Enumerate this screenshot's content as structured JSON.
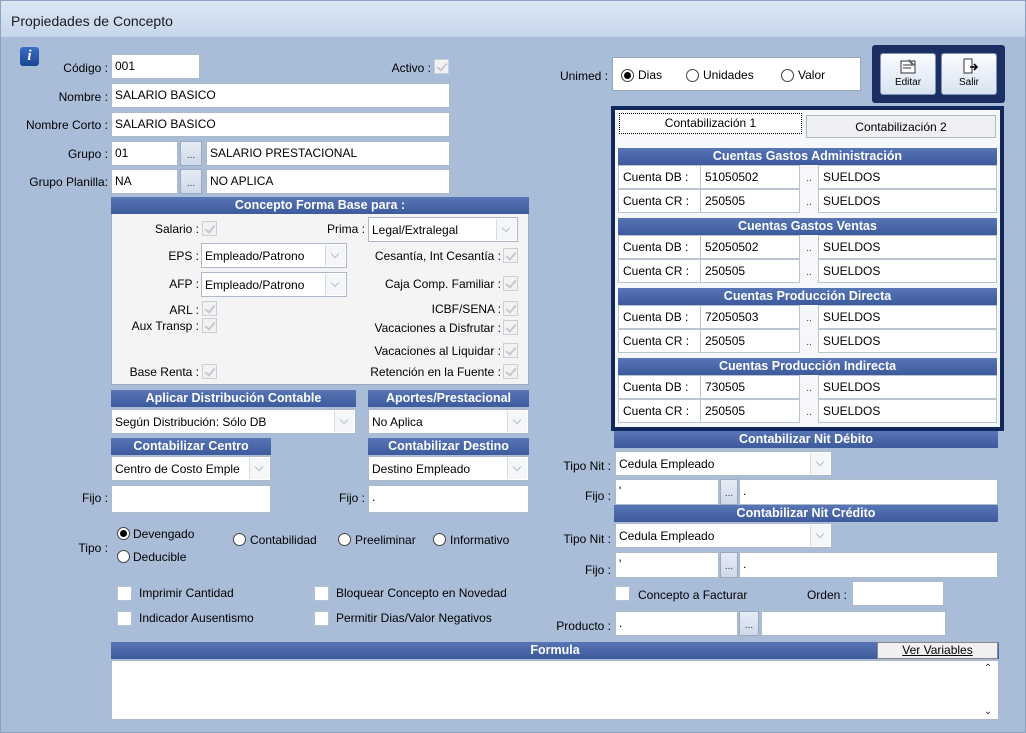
{
  "window": {
    "title": "Propiedades de Concepto"
  },
  "form": {
    "codigo_label": "Código :",
    "codigo_value": "001",
    "activo_label": "Activo :",
    "nombre_label": "Nombre :",
    "nombre_value": "SALARIO BASICO",
    "nombre_corto_label": "Nombre Corto :",
    "nombre_corto_value": "SALARIO BASICO",
    "grupo_label": "Grupo :",
    "grupo_code": "01",
    "grupo_name": "SALARIO PRESTACIONAL",
    "grupo_planilla_label": "Grupo Planilla:",
    "grupo_planilla_code": "NA",
    "grupo_planilla_name": "NO APLICA",
    "ellipsis": "...",
    "dots": ".."
  },
  "unimed": {
    "label": "Unimed :",
    "options": [
      "Dias",
      "Unidades",
      "Valor"
    ],
    "selected": "Dias"
  },
  "toolbar": {
    "editar": "Editar",
    "salir": "Salir"
  },
  "base": {
    "title": "Concepto Forma Base para :",
    "salario": "Salario :",
    "prima": "Prima :",
    "prima_value": "Legal/Extralegal",
    "eps": "EPS :",
    "eps_value": "Empleado/Patrono",
    "cesantia": "Cesantía, Int Cesantía :",
    "afp": "AFP :",
    "afp_value": "Empleado/Patrono",
    "caja": "Caja Comp. Familiar :",
    "arl": "ARL :",
    "icbf": "ICBF/SENA :",
    "aux": "Aux Transp :",
    "vac_disfrutar": "Vacaciones a Disfrutar :",
    "vac_liquidar": "Vacaciones al Liquidar :",
    "base_renta": "Base Renta :",
    "retencion": "Retención en la Fuente :"
  },
  "distribucion": {
    "title": "Aplicar Distribución Contable",
    "value": "Según Distribución: Sólo DB"
  },
  "aportes": {
    "title": "Aportes/Prestacional",
    "value": "No Aplica"
  },
  "centro": {
    "title": "Contabilizar Centro",
    "value": "Centro de Costo Emple",
    "fijo_label": "Fijo :",
    "fijo_value": ""
  },
  "destino": {
    "title": "Contabilizar Destino",
    "value": "Destino Empleado",
    "fijo_label": "Fijo :",
    "fijo_value": "."
  },
  "tipo": {
    "label": "Tipo :",
    "options": [
      "Devengado",
      "Contabilidad",
      "Preeliminar",
      "Informativo",
      "Deducible"
    ],
    "selected": "Devengado"
  },
  "checks": {
    "imprimir": "Imprimir Cantidad",
    "bloquear": "Bloquear Concepto en Novedad",
    "ausentismo": "Indicador Ausentismo",
    "negativos": "Permitir Dias/Valor Negativos"
  },
  "contab": {
    "tabs": [
      "Contabilización 1",
      "Contabilización 2"
    ],
    "db_label": "Cuenta DB :",
    "cr_label": "Cuenta CR :",
    "sections": [
      {
        "title": "Cuentas Gastos Administración",
        "db": "51050502",
        "db_name": "SUELDOS",
        "cr": "250505",
        "cr_name": "SUELDOS"
      },
      {
        "title": "Cuentas Gastos Ventas",
        "db": "52050502",
        "db_name": "SUELDOS",
        "cr": "250505",
        "cr_name": "SUELDOS"
      },
      {
        "title": "Cuentas Producción Directa",
        "db": "72050503",
        "db_name": "SUELDOS",
        "cr": "250505",
        "cr_name": "SUELDOS"
      },
      {
        "title": "Cuentas Producción Indirecta",
        "db": "730505",
        "db_name": "SUELDOS",
        "cr": "250505",
        "cr_name": "SUELDOS"
      }
    ]
  },
  "nit_debito": {
    "title": "Contabilizar Nit Débito",
    "tipo_label": "Tipo Nit :",
    "tipo_value": "Cedula Empleado",
    "fijo_label": "Fijo :",
    "fijo_code": "'",
    "fijo_name": "."
  },
  "nit_credito": {
    "title": "Contabilizar Nit Crédito",
    "tipo_label": "Tipo Nit :",
    "tipo_value": "Cedula Empleado",
    "fijo_label": "Fijo :",
    "fijo_code": "'",
    "fijo_name": "."
  },
  "facturar": {
    "label": "Concepto a Facturar",
    "orden_label": "Orden :",
    "orden_value": ""
  },
  "producto": {
    "label": "Producto :",
    "code": ".",
    "name": ""
  },
  "formula": {
    "title": "Formula",
    "ver_variables": "Ver Variables"
  }
}
